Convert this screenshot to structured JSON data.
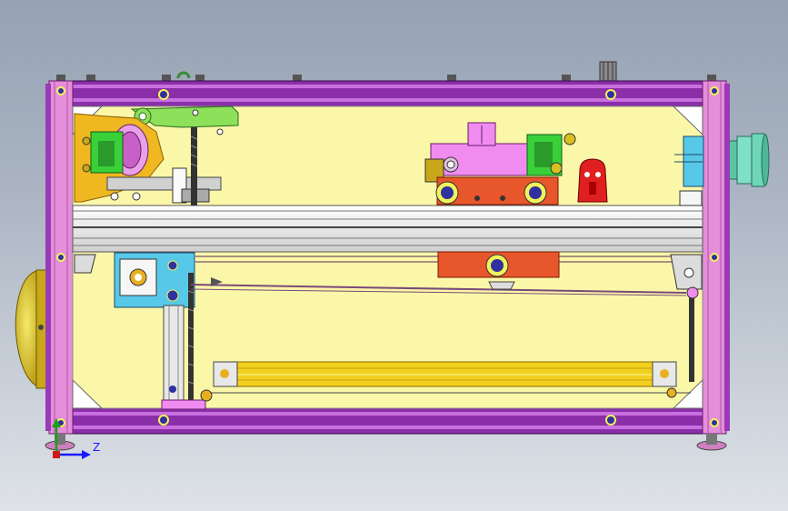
{
  "viewport": {
    "background_top": "#96a2b3",
    "background_bottom": "#dfe3e8"
  },
  "triad": {
    "z_label": "Z",
    "z_color": "#1a1aff",
    "y_color": "#1aa01a",
    "origin_color": "#d01a1a"
  },
  "colors": {
    "frame_pink": "#e48fd8",
    "frame_purple": "#8a2fa8",
    "panel_yellow": "#fbf7a8",
    "rail_white": "#f4f4f4",
    "carriage_red": "#e8562c",
    "motor_pink": "#f08cf0",
    "bracket_green": "#3ad03a",
    "gold": "#d8c020",
    "teal": "#6fd6b8",
    "cyan": "#58c8e8",
    "wheel_yellow": "#f2f25a",
    "wheel_blue": "#3030a0",
    "red_part": "#e02020",
    "belt_dark": "#444444"
  }
}
